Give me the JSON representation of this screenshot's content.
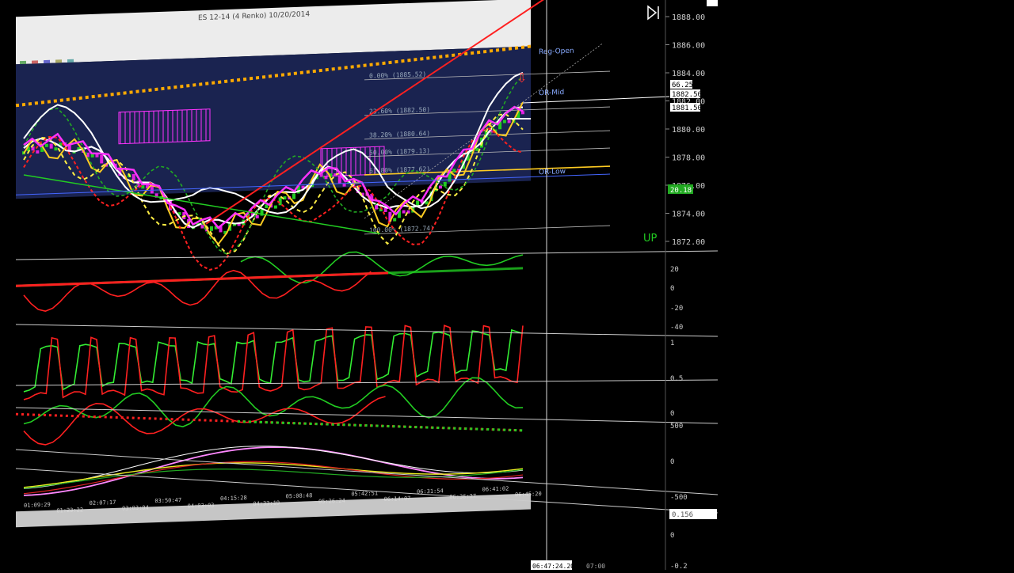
{
  "window": {
    "title": "ES 12-14 (4 Renko)  10/20/2014"
  },
  "colors": {
    "panel_bg": "#1a2350",
    "band": "#2a3a8a",
    "up_candle": "#22cc22",
    "down_candle": "#e020e0",
    "red": "#ff2020",
    "green": "#22cc22",
    "yellow": "#ffcc22",
    "orange_dots": "#ffaa00",
    "white": "#ffffff",
    "pink": "#ff88ff",
    "blue_label": "#4488ff",
    "label_green": "#22cc22"
  },
  "main_panel": {
    "price_axis": [
      "1888.00",
      "1886.00",
      "1884.00",
      "1882.00",
      "1880.00",
      "1878.00",
      "1876.00",
      "1874.00",
      "1872.00"
    ],
    "price_badges": {
      "p1": "66.25",
      "p2": "1882.50",
      "p3": "1881.50",
      "p4": "20.18"
    },
    "levels": [
      {
        "label": "Reg-Open",
        "kind": "line"
      },
      {
        "label": "OR-Mid",
        "kind": "line"
      },
      {
        "label": "OR-Low",
        "kind": "line"
      }
    ],
    "fib_labels": [
      "0.00% (1885.52)",
      "23.60% (1882.50)",
      "38.20% (1880.64)",
      "50.00% (1879.13)",
      "61.80% (1877.62)",
      "100.00% (1872.74)"
    ],
    "trend_label": "UP"
  },
  "osc1": {
    "axis": [
      "20",
      "0",
      "-20",
      "-40"
    ]
  },
  "osc2": {
    "axis": [
      "1",
      "0.5",
      "0"
    ]
  },
  "osc3": {
    "axis": [
      "500",
      "0",
      "-500"
    ]
  },
  "osc4": {
    "axis": [
      "0",
      "-0.2"
    ],
    "badge": "0.156"
  },
  "time_axis": [
    "01:09:29",
    "01:23:22",
    "02:07:17",
    "03:03:04",
    "03:50:47",
    "04:03:03",
    "04:15:28",
    "04:33:19",
    "05:08:48",
    "05:26:24",
    "05:42:51",
    "06:14:07",
    "06:31:54",
    "06:36:27",
    "06:41:02",
    "06:45:20",
    "06:47:24.20",
    "07:00"
  ],
  "chart_data": {
    "type": "line",
    "title": "ES 12-14 (4 Renko)  10/20/2014",
    "x": [
      "01:09:29",
      "01:23:22",
      "02:07:17",
      "03:03:04",
      "03:50:47",
      "04:03:03",
      "04:15:28",
      "04:33:19",
      "05:08:48",
      "05:26:24",
      "05:42:51",
      "06:14:07",
      "06:31:54",
      "06:36:27",
      "06:41:02",
      "06:45:20"
    ],
    "ylim": [
      1871,
      1889
    ],
    "series": [
      {
        "values": [
          1881.5,
          1882.0,
          1881.0,
          1879.0,
          1877.0,
          1874.0,
          1873.5,
          1875.0,
          1876.5,
          1878.5,
          1877.0,
          1874.0,
          1875.5,
          1878.5,
          1882.0,
          1883.5
        ]
      }
    ],
    "annotations": [
      "Reg-Open",
      "OR-Mid",
      "OR-Low",
      "UP"
    ]
  }
}
